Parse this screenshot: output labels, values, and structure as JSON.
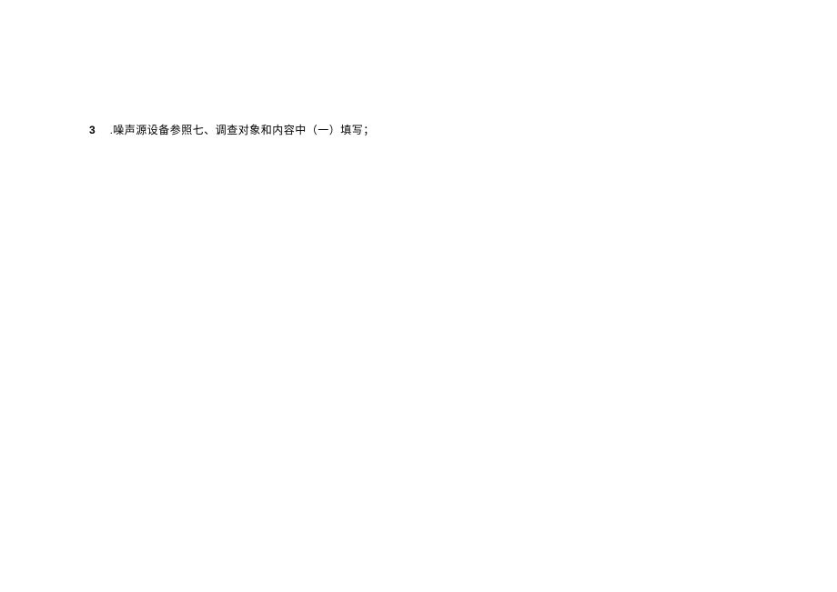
{
  "document": {
    "item_number": "3",
    "item_text": ".噪声源设备参照七、调查对象和内容中（一）填写；"
  }
}
